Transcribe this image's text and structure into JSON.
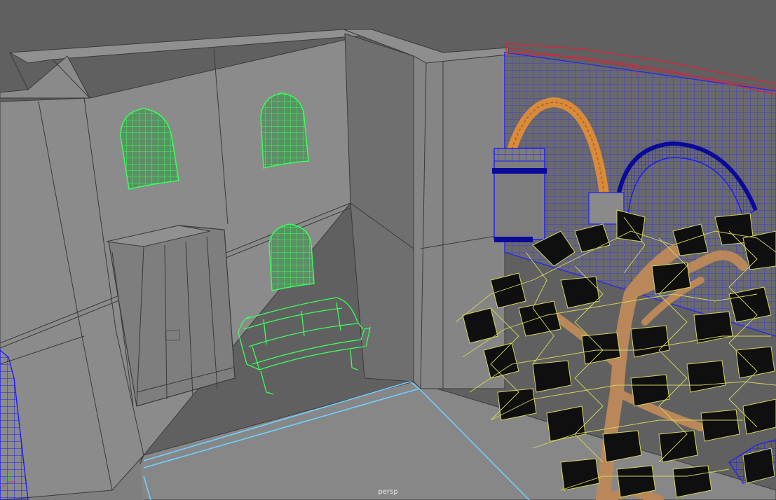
{
  "viewport": {
    "camera_name": "persp",
    "panel_type": "perspective-viewport"
  },
  "axis_gizmo": {
    "x_label": "X",
    "y_label": "Y",
    "z_label": "Z"
  },
  "colors": {
    "background": "#636363",
    "wall_light": "#8c8c8c",
    "wall_mid": "#7d7d7d",
    "wall_dark": "#6e6e6e",
    "floor": "#858585",
    "edge": "#3a3a3a",
    "selected_green": "#39ff5a",
    "blue_wire": "#1a1aff",
    "red_wire": "#e0203a",
    "orange_arch": "#d98a3a",
    "tree_yellow": "#d6d65a",
    "tree_leaf_dark": "#0f0f0f",
    "trunk": "#b9875a",
    "floor_line_cyan": "#6fd0ff"
  }
}
